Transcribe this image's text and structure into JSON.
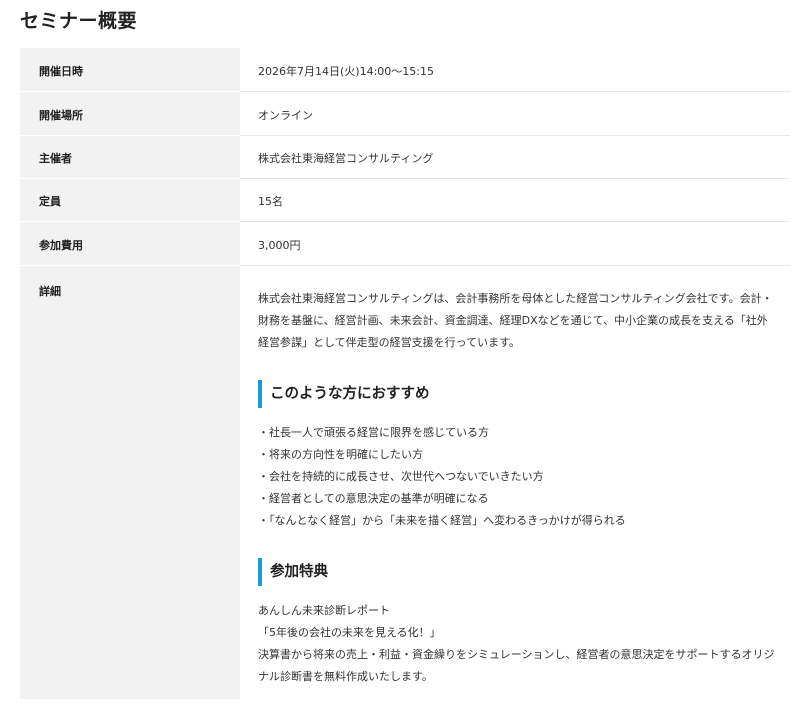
{
  "page_title": "セミナー概要",
  "rows": [
    {
      "label": "開催日時",
      "value": "2026年7月14日(火)14:00～15:15"
    },
    {
      "label": "開催場所",
      "value": "オンライン"
    },
    {
      "label": "主催者",
      "value": "株式会社東海経営コンサルティング"
    },
    {
      "label": "定員",
      "value": "15名"
    },
    {
      "label": "参加費用",
      "value": "3,000円"
    }
  ],
  "detail": {
    "label": "詳細",
    "intro": "株式会社東海経営コンサルティングは、会計事務所を母体とした経営コンサルティング会社です。会計・財務を基盤に、経営計画、未来会計、資金調達、経理DXなどを通じて、中小企業の成長を支える「社外経営参謀」として伴走型の経営支援を行っています。",
    "recommend_heading": "このような方におすすめ",
    "recommend_items": [
      "・社長一人で頑張る経営に限界を感じている方",
      "・将来の方向性を明確にしたい方",
      "・会社を持続的に成長させ、次世代へつないでいきたい方",
      "・経営者としての意思決定の基準が明確になる",
      "・「なんとなく経営」から「未来を描く経営」へ変わるきっかけが得られる"
    ],
    "benefit_heading": "参加特典",
    "benefit_lines": [
      "あんしん未来診断レポート",
      "「5年後の会社の未来を見える化！」"
    ],
    "benefit_text": "決算書から将来の売上・利益・資金繰りをシミュレーションし、経営者の意思決定をサポートするオリジナル診断書を無料作成いたします。"
  },
  "colors": {
    "label_bg": "#f2f2f2",
    "accent": "#1a9ad6"
  }
}
